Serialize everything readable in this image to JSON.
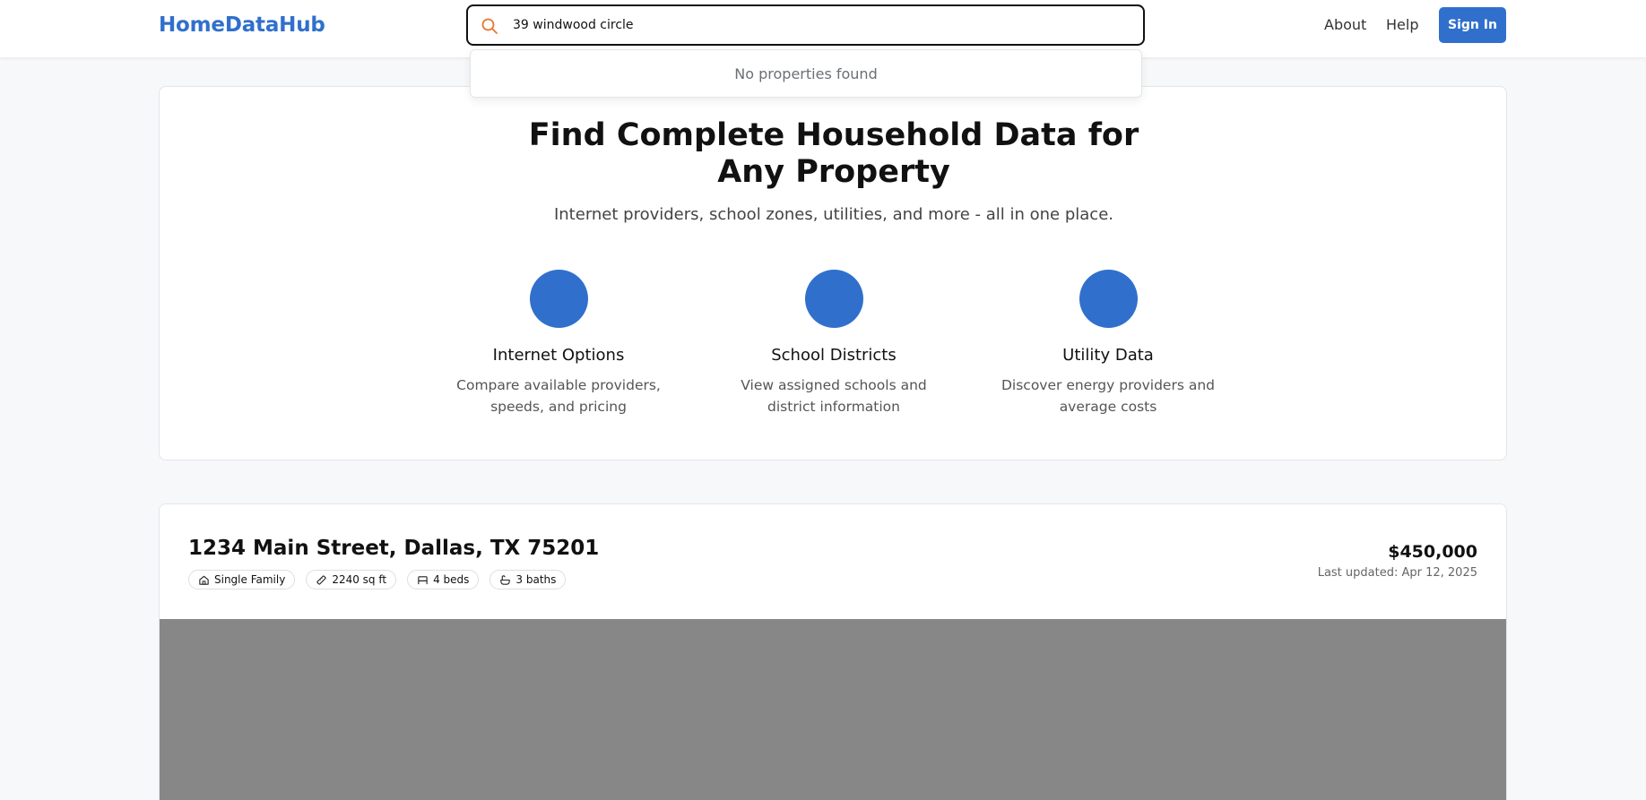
{
  "header": {
    "logo": "HomeDataHub",
    "search": {
      "value": "39 windwood circle",
      "icon": "search-icon",
      "icon_color": "#e8772e"
    },
    "nav": {
      "about": "About",
      "help": "Help",
      "sign_in": "Sign In"
    }
  },
  "dropdown": {
    "empty_text": "No properties found"
  },
  "hero": {
    "title": "Find Complete Household Data for Any Property",
    "subtitle": "Internet providers, school zones, utilities, and more - all in one place.",
    "features": [
      {
        "title": "Internet Options",
        "desc": "Compare available providers, speeds, and pricing"
      },
      {
        "title": "School Districts",
        "desc": "View assigned schools and district information"
      },
      {
        "title": "Utility Data",
        "desc": "Discover energy providers and average costs"
      }
    ]
  },
  "property": {
    "address": "1234 Main Street, Dallas, TX 75201",
    "tags": [
      {
        "icon": "home-icon",
        "label": "Single Family"
      },
      {
        "icon": "ruler-icon",
        "label": "2240 sq ft"
      },
      {
        "icon": "bed-icon",
        "label": "4 beds"
      },
      {
        "icon": "bath-icon",
        "label": "3 baths"
      }
    ],
    "price": "$450,000",
    "updated": "Last updated: Apr 12, 2025"
  },
  "colors": {
    "brand": "#3070cc",
    "page_bg": "#f7f8fa",
    "map_placeholder": "#878787"
  }
}
